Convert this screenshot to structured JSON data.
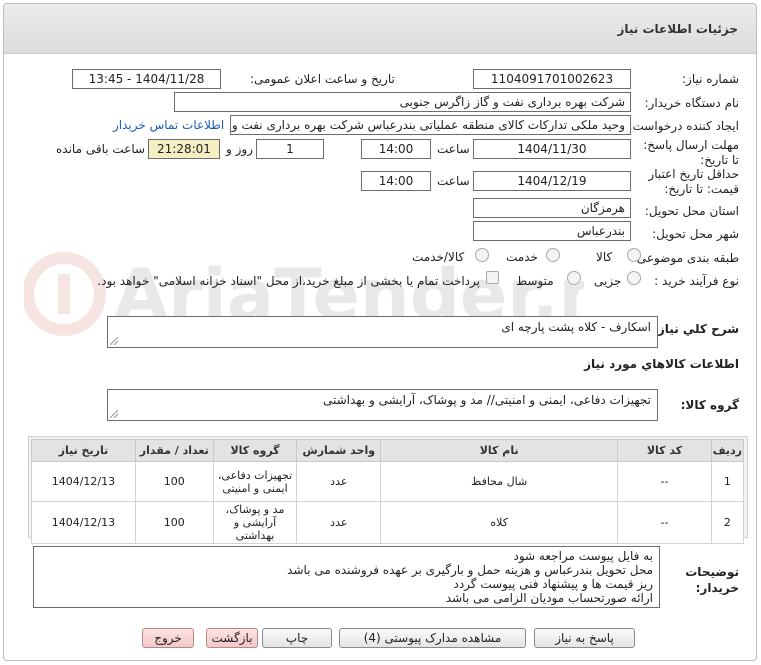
{
  "page": {
    "title": "جزئیات اطلاعات نیاز"
  },
  "form": {
    "need_number_label": "شماره نیاز:",
    "need_number": "1104091701002623",
    "announce_label": "تاریخ و ساعت اعلان عمومی:",
    "announce_value": "1404/11/28 - 13:45",
    "buyer_org_label": "نام دستگاه خریدار:",
    "buyer_org": "شرکت بهره برداری نفت و گاز زاگرس جنوبی",
    "creator_label": "ایجاد کننده درخواست:",
    "creator": "وحید ملکی تدارکات کالای منطقه عملیاتی بندرعباس شرکت بهره برداری نفت و",
    "contact_link": "اطلاعات تماس خریدار",
    "deadline_label": "مهلت ارسال پاسخ: تا تاریخ:",
    "deadline_date": "1404/11/30",
    "time_label": "ساعت",
    "deadline_time": "14:00",
    "days_value": "1",
    "days_label": "روز و",
    "remaining_value": "21:28:01",
    "remaining_label": "ساعت باقی مانده",
    "validity_label": "حداقل تاریخ اعتبار قیمت: تا تاریخ:",
    "validity_date": "1404/12/19",
    "validity_time": "14:00",
    "province_label": "استان محل تحویل:",
    "province": "هرمزگان",
    "city_label": "شهر محل تحویل:",
    "city": "بندرعباس",
    "category_label": "طبقه بندی موضوعی:",
    "category_options": [
      "کالا",
      "خدمت",
      "کالا/خدمت"
    ],
    "process_label": "نوع فرآیند خرید :",
    "process_options": [
      "جزیی",
      "متوسط"
    ],
    "payment_note": "پرداخت تمام یا بخشی از مبلغ خرید،از محل \"اسناد خزانه اسلامی\" خواهد بود.",
    "summary_label": "شرح کلي نياز:",
    "summary": "اسکارف - کلاه پشت پارچه ای",
    "goods_info_title": "اطلاعات کالاهاي مورد نياز",
    "goods_group_label": "گروه کالا:",
    "goods_group": "تجهیزات دفاعی، ایمنی و امنیتی// مد و پوشاک، آرایشی و بهداشتی",
    "buyer_notes_label": "توضیحات خریدار:",
    "buyer_notes": [
      "به فایل پیوست مراجعه شود",
      "محل تحویل بندرعباس و هزینه حمل و بارگیری بر عهده فروشنده می باشد",
      "ریز قیمت ها و پیشنهاد فنی پیوست گردد",
      "ارائه صورتحساب مودیان الزامی می باشد"
    ]
  },
  "table": {
    "headers": [
      "ردیف",
      "کد کالا",
      "نام کالا",
      "واحد شمارش",
      "گروه کالا",
      "تعداد / مقدار",
      "تاریخ نیاز"
    ],
    "rows": [
      [
        "1",
        "--",
        "شال محافظ",
        "عدد",
        "تجهیزات دفاعی، ایمنی و امنیتی",
        "100",
        "1404/12/13"
      ],
      [
        "2",
        "--",
        "کلاه",
        "عدد",
        "مد و پوشاک، آرایشی و بهداشتی",
        "100",
        "1404/12/13"
      ]
    ]
  },
  "buttons": {
    "reply": "پاسخ به نیاز",
    "attachments": "مشاهده مدارک پیوستی (4)",
    "print": "چاپ",
    "back": "بازگشت",
    "exit": "خروج"
  },
  "colors": {
    "link": "#1a5fb4",
    "remaining_bg": "#f3efc2",
    "header_bg": "#e3e3e3"
  }
}
